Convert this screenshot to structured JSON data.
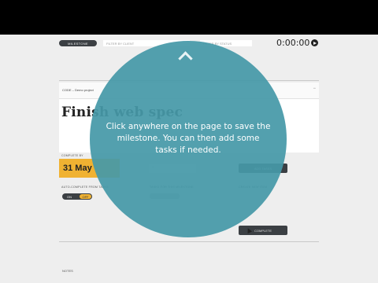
{
  "toolbar": {
    "milestone_label": "MILESTONE",
    "filter_client_placeholder": "FILTER BY CLIENT",
    "filter_status_placeholder": "FILTER BY STATUS",
    "timer": "0:00:00"
  },
  "project": {
    "name": "CODE – Demo project",
    "collapse_icon": "−"
  },
  "milestone": {
    "title": "Finish web spec",
    "complete_by_label": "COMPLETE BY",
    "complete_by_value": "31 May",
    "empty_value": "–",
    "add_tasks_button": "ADD TASKS",
    "auto_complete_label": "AUTO-COMPLETE FROM TASKS",
    "toggle_on": "ON",
    "toggle_off": "OFF",
    "third_label": "TASKS FOR THIS MILESTONE",
    "create_label": "CREATE NEW ITEM",
    "complete_button": "COMPLETE"
  },
  "notes": {
    "label": "NOTES"
  },
  "overlay": {
    "message": "Click anywhere on the page to save the milestone. You can then add some tasks if needed.",
    "bg_color": "#4699a8"
  }
}
